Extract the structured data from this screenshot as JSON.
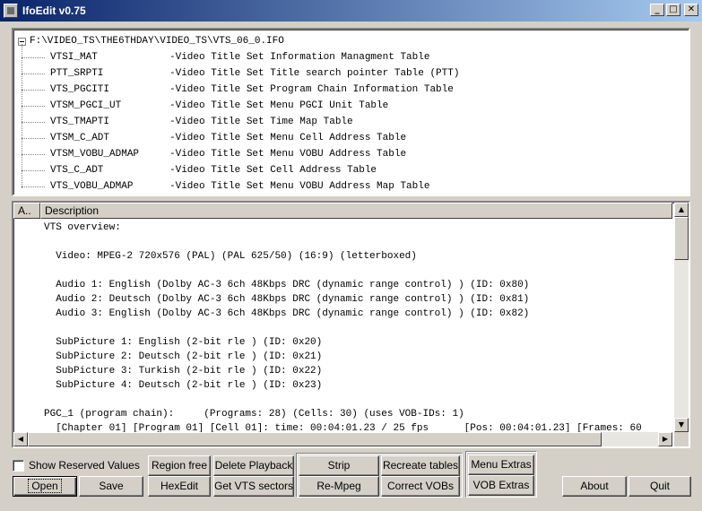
{
  "window": {
    "title": "IfoEdit v0.75",
    "controls": {
      "minimize": "_",
      "maximize": "□",
      "close": "✕"
    }
  },
  "tree": {
    "root": "F:\\VIDEO_TS\\THE6THDAY\\VIDEO_TS\\VTS_06_0.IFO",
    "items": [
      {
        "name": "VTSI_MAT",
        "desc": "-Video Title Set Information Managment Table"
      },
      {
        "name": "PTT_SRPTI",
        "desc": "-Video Title Set Title search pointer Table (PTT)"
      },
      {
        "name": "VTS_PGCITI",
        "desc": "-Video Title Set Program Chain Information Table"
      },
      {
        "name": "VTSM_PGCI_UT",
        "desc": "-Video Title Set Menu PGCI Unit Table"
      },
      {
        "name": "VTS_TMAPTI",
        "desc": "-Video Title Set Time Map Table"
      },
      {
        "name": "VTSM_C_ADT",
        "desc": "-Video Title Set Menu Cell Address Table"
      },
      {
        "name": "VTSM_VOBU_ADMAP",
        "desc": "-Video Title Set Menu VOBU Address Table"
      },
      {
        "name": "VTS_C_ADT",
        "desc": "-Video Title Set Cell Address Table"
      },
      {
        "name": "VTS_VOBU_ADMAP",
        "desc": "-Video Title Set Menu VOBU Address Map Table"
      }
    ]
  },
  "detail": {
    "columns": [
      "A..",
      "Description"
    ],
    "lines": [
      "VTS overview:",
      "",
      "  Video: MPEG-2 720x576 (PAL) (PAL 625/50) (16:9) (letterboxed)",
      "",
      "  Audio 1: English (Dolby AC-3 6ch 48Kbps DRC (dynamic range control) ) (ID: 0x80)",
      "  Audio 2: Deutsch (Dolby AC-3 6ch 48Kbps DRC (dynamic range control) ) (ID: 0x81)",
      "  Audio 3: English (Dolby AC-3 6ch 48Kbps DRC (dynamic range control) ) (ID: 0x82)",
      "",
      "  SubPicture 1: English (2-bit rle ) (ID: 0x20)",
      "  SubPicture 2: Deutsch (2-bit rle ) (ID: 0x21)",
      "  SubPicture 3: Turkish (2-bit rle ) (ID: 0x22)",
      "  SubPicture 4: Deutsch (2-bit rle ) (ID: 0x23)",
      "",
      "PGC_1 (program chain):     (Programs: 28) (Cells: 30) (uses VOB-IDs: 1)",
      "  [Chapter 01] [Program 01] [Cell 01]: time: 00:04:01.23 / 25 fps      [Pos: 00:04:01.23] [Frames: 60"
    ]
  },
  "scroll": {
    "up": "▲",
    "down": "▼",
    "left": "◀",
    "right": "▶"
  },
  "buttons": {
    "show_reserved": "Show Reserved Values",
    "open": "Open",
    "save": "Save",
    "region_free": "Region free",
    "hexedit": "HexEdit",
    "delete_playback": "Delete Playback",
    "get_vts_sectors": "Get VTS sectors",
    "strip": "Strip",
    "re_mpeg": "Re-Mpeg",
    "recreate_tables": "Recreate tables",
    "correct_vobs": "Correct VOBs",
    "menu_extras": "Menu Extras",
    "vob_extras": "VOB Extras",
    "about": "About",
    "quit": "Quit"
  }
}
